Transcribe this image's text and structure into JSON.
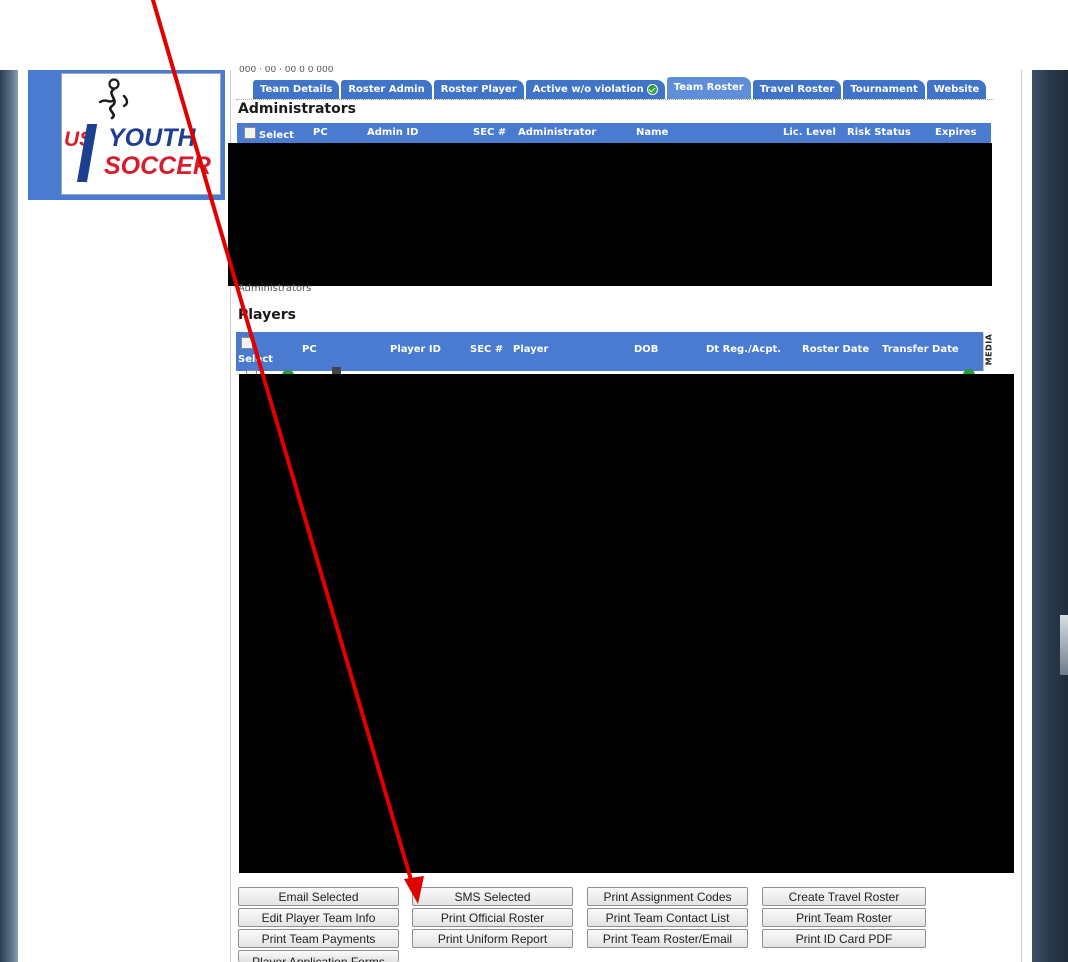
{
  "logo": {
    "line1": "US",
    "line2": "YOUTH",
    "line3": "SOCCER"
  },
  "tabs": [
    {
      "label": "Team Details",
      "active": false
    },
    {
      "label": "Roster Admin",
      "active": false
    },
    {
      "label": "Roster Player",
      "active": false
    },
    {
      "label": "Active w/o violation",
      "active": false,
      "icon": "check-icon"
    },
    {
      "label": "Team Roster",
      "active": true
    },
    {
      "label": "Travel Roster",
      "active": false
    },
    {
      "label": "Tournament",
      "active": false
    },
    {
      "label": "Website",
      "active": false
    }
  ],
  "administrators": {
    "title": "Administrators",
    "columns": [
      "Select",
      "PC",
      "Admin ID",
      "SEC #",
      "Administrator",
      "Name",
      "Lic. Level",
      "Risk Status",
      "Expires"
    ],
    "footer_note": "Administrators"
  },
  "players": {
    "title": "Players",
    "columns": [
      "Select",
      "PC",
      "Player ID",
      "SEC #",
      "Player",
      "DOB",
      "Dt Reg./Acpt.",
      "Roster Date",
      "Transfer Date"
    ],
    "media_label": "MEDIA"
  },
  "buttons": [
    [
      "Email Selected",
      "SMS Selected",
      "Print Assignment Codes",
      "Create Travel Roster"
    ],
    [
      "Edit Player Team Info",
      "Print Official Roster",
      "Print Team Contact List",
      "Print Team Roster"
    ],
    [
      "Print Team Payments",
      "Print Uniform Report",
      "Print Team Roster/Email",
      "Print ID Card PDF"
    ],
    [
      "Player Application Forms"
    ]
  ],
  "colors": {
    "header_blue": "#4a7bd1",
    "tab_blue": "#3f74c8",
    "arrow_red": "#e00000",
    "redaction": "#000000"
  }
}
